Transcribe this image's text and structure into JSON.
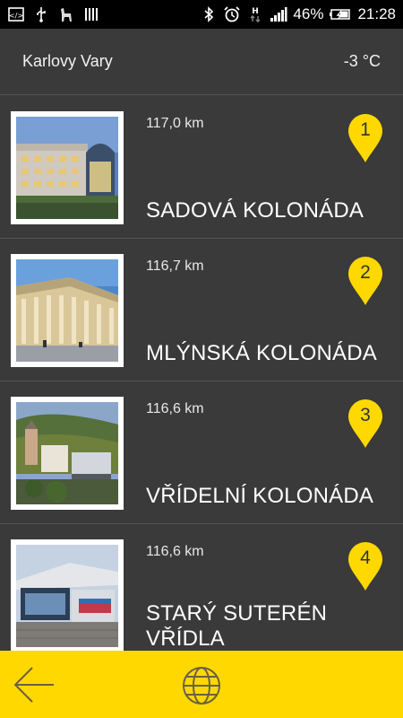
{
  "status_bar": {
    "icons": [
      "code-icon",
      "usb-icon",
      "llama-icon",
      "barcode-icon",
      "bluetooth-icon",
      "alarm-icon",
      "data-h-icon",
      "signal-icon",
      "battery-charging-icon"
    ],
    "battery": "46%",
    "time": "21:28"
  },
  "header": {
    "city": "Karlovy Vary",
    "temperature": "-3 °C"
  },
  "places": [
    {
      "number": "1",
      "distance": "117,0 km",
      "name": "SADOVÁ KOLONÁDA"
    },
    {
      "number": "2",
      "distance": "116,7 km",
      "name": "MLÝNSKÁ KOLONÁDA"
    },
    {
      "number": "3",
      "distance": "116,6 km",
      "name": "VŘÍDELNÍ KOLONÁDA"
    },
    {
      "number": "4",
      "distance": "116,6 km",
      "name": "STARÝ SUTERÉN VŘÍDLA"
    }
  ],
  "bottom_bar": {
    "icons": [
      "back-arrow-icon",
      "globe-icon"
    ]
  },
  "colors": {
    "accent": "#ffd800",
    "background": "#3a3a3a",
    "divider": "#555555"
  }
}
